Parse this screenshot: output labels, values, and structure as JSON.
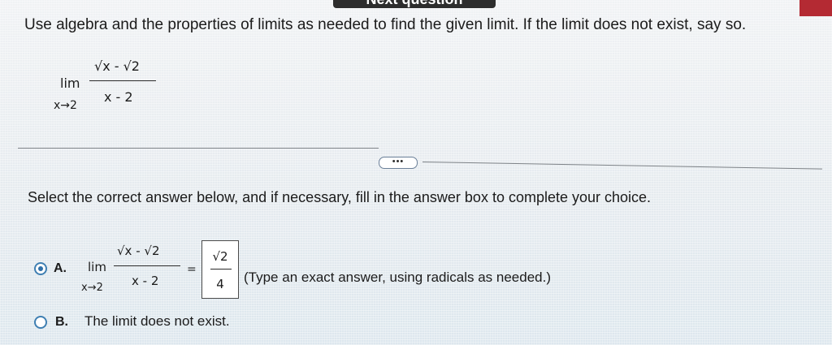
{
  "header": {
    "tab_label": "Next question"
  },
  "question": {
    "prompt": "Use algebra and the properties of limits as needed to find the given limit. If the limit does not exist, say so.",
    "limit_word": "lim",
    "limit_subscript": "x→2",
    "numerator": "√x - √2",
    "denominator": "x - 2"
  },
  "more_button": {
    "label": "•••"
  },
  "instruction": "Select the correct answer below, and if necessary, fill in the answer box to complete your choice.",
  "options": {
    "a": {
      "letter": "A.",
      "selected": true,
      "limit_word": "lim",
      "limit_subscript": "x→2",
      "numerator": "√x - √2",
      "denominator": "x - 2",
      "equals": "=",
      "answer_numerator": "√2",
      "answer_denominator": "4",
      "hint": "(Type an exact answer, using radicals as needed.)"
    },
    "b": {
      "letter": "B.",
      "selected": false,
      "text": "The limit does not exist."
    }
  },
  "colors": {
    "radio_accent": "#2f6fa7",
    "tab_bg": "#2d2d2d",
    "corner_red": "#b42a33"
  }
}
